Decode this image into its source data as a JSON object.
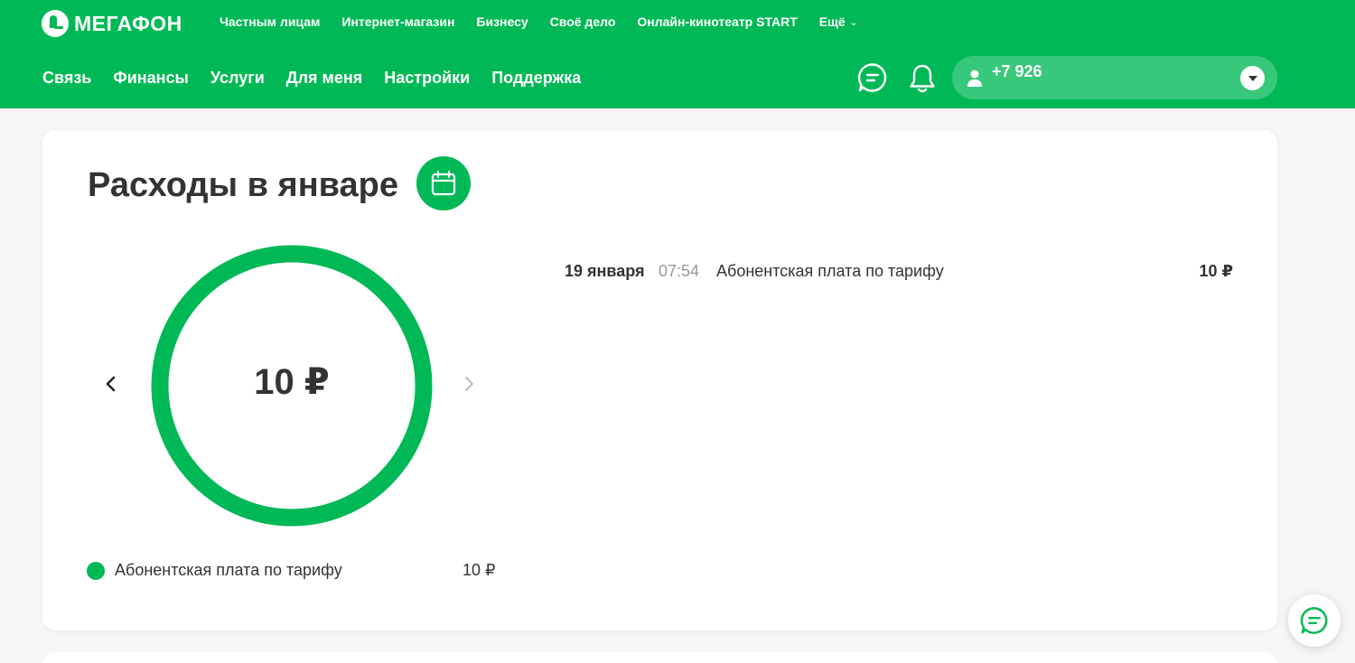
{
  "header": {
    "logo_text": "МЕГАФОН",
    "top_nav": [
      "Частным лицам",
      "Интернет-магазин",
      "Бизнесу",
      "Своё дело",
      "Онлайн-кинотеатр START",
      "Ещё"
    ],
    "main_nav": [
      "Связь",
      "Финансы",
      "Услуги",
      "Для меня",
      "Настройки",
      "Поддержка"
    ],
    "account_phone": "+7 926"
  },
  "expenses": {
    "title": "Расходы в январе",
    "total": "10 ₽",
    "legend": [
      {
        "label": "Абонентская плата по тарифу",
        "value": "10 ₽",
        "color": "#00b956"
      }
    ],
    "transactions": [
      {
        "date": "19 января",
        "time": "07:54",
        "description": "Абонентская плата по тарифу",
        "amount": "10 ₽"
      }
    ]
  },
  "colors": {
    "brand_green": "#00b956"
  },
  "icons": [
    "megafon-logo-icon",
    "chat-icon",
    "bell-icon",
    "user-icon",
    "chevron-down-icon",
    "calendar-icon",
    "chevron-left-icon",
    "chevron-right-icon"
  ]
}
